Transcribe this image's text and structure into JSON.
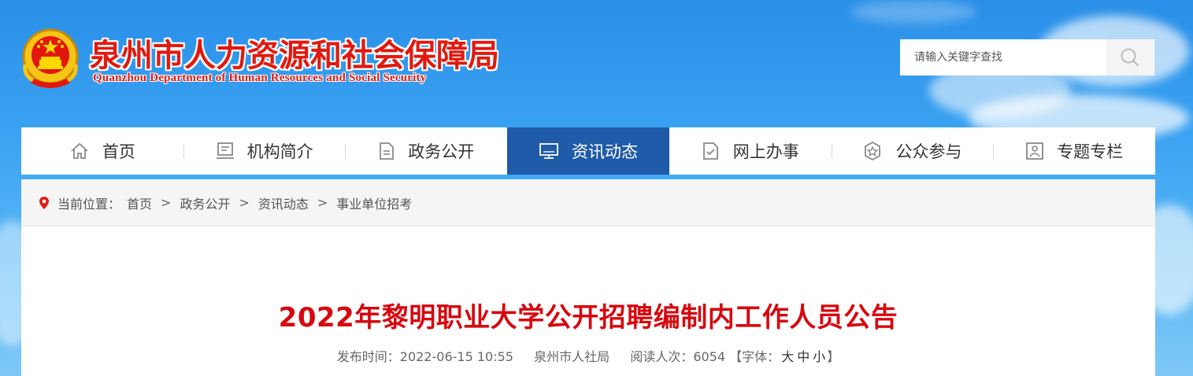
{
  "header": {
    "title_cn": "泉州市人力资源和社会保障局",
    "title_en": "Quanzhou Department of Human Resources and Social Security",
    "emblem_icon": "national-emblem-icon"
  },
  "search": {
    "placeholder": "请输入关键字查找",
    "icon": "search-icon"
  },
  "nav": {
    "items": [
      {
        "label": "首页",
        "icon": "home-icon"
      },
      {
        "label": "机构简介",
        "icon": "org-info-icon"
      },
      {
        "label": "政务公开",
        "icon": "document-icon"
      },
      {
        "label": "资讯动态",
        "icon": "monitor-icon",
        "active": true
      },
      {
        "label": "网上办事",
        "icon": "online-service-icon"
      },
      {
        "label": "公众参与",
        "icon": "participation-icon"
      },
      {
        "label": "专题专栏",
        "icon": "topic-icon"
      }
    ],
    "active_color": "#1f5ba8"
  },
  "breadcrumb": {
    "prefix": "当前位置：",
    "items": [
      "首页",
      "政务公开",
      "资讯动态",
      "事业单位招考"
    ],
    "separator": ">"
  },
  "article": {
    "title": "2022年黎明职业大学公开招聘编制内工作人员公告",
    "publish_label": "发布时间：",
    "publish_time": "2022-06-15 10:55",
    "source": "泉州市人社局",
    "views_label": "阅读人次：",
    "views": "6054",
    "font_label_open": "【字体：",
    "font_large": "大",
    "font_medium": "中",
    "font_small": "小",
    "font_label_close": "】",
    "title_color": "#d7080f"
  },
  "colors": {
    "brand_red": "#e01a10",
    "sky_blue": "#3aa2f2"
  }
}
